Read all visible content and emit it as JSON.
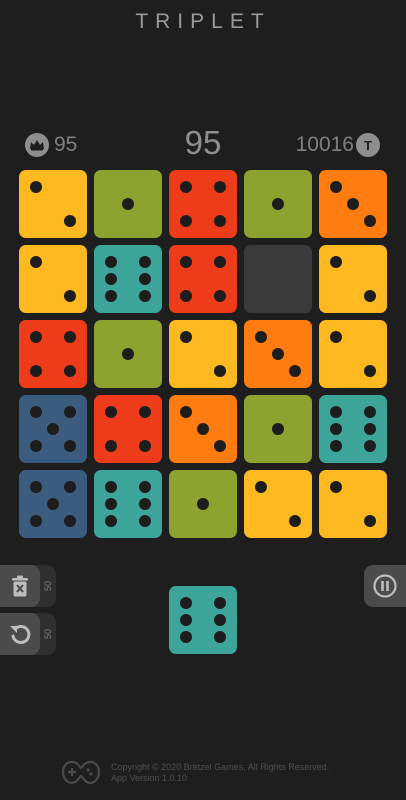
{
  "header": {
    "title": "TRIPLET"
  },
  "scores": {
    "best": "95",
    "current": "95",
    "coins": "10016",
    "token_letter": "T"
  },
  "colors": {
    "yellow": "#fdb91f",
    "olive": "#8ea22f",
    "red": "#ee3c1a",
    "orange": "#ff7c10",
    "teal": "#3da49a",
    "blue": "#3c5c7f",
    "empty": "#3a3a3a"
  },
  "board": [
    [
      {
        "color": "yellow",
        "value": 2
      },
      {
        "color": "olive",
        "value": 1
      },
      {
        "color": "red",
        "value": 4
      },
      {
        "color": "olive",
        "value": 1
      },
      {
        "color": "orange",
        "value": 3
      }
    ],
    [
      {
        "color": "yellow",
        "value": 2
      },
      {
        "color": "teal",
        "value": 6
      },
      {
        "color": "red",
        "value": 4
      },
      {
        "color": "empty",
        "value": 0
      },
      {
        "color": "yellow",
        "value": 2
      }
    ],
    [
      {
        "color": "red",
        "value": 4
      },
      {
        "color": "olive",
        "value": 1
      },
      {
        "color": "yellow",
        "value": 2
      },
      {
        "color": "orange",
        "value": 3
      },
      {
        "color": "yellow",
        "value": 2
      }
    ],
    [
      {
        "color": "blue",
        "value": 5
      },
      {
        "color": "red",
        "value": 4
      },
      {
        "color": "orange",
        "value": 3
      },
      {
        "color": "olive",
        "value": 1
      },
      {
        "color": "teal",
        "value": 6
      }
    ],
    [
      {
        "color": "blue",
        "value": 5
      },
      {
        "color": "teal",
        "value": 6
      },
      {
        "color": "olive",
        "value": 1
      },
      {
        "color": "yellow",
        "value": 2
      },
      {
        "color": "yellow",
        "value": 2
      }
    ]
  ],
  "next_die": {
    "color": "teal",
    "value": 6
  },
  "tools": {
    "trash_cost": "50",
    "undo_cost": "50"
  },
  "footer": {
    "copyright": "Copyright © 2020 Bretzel Games, All Rights Reserved.",
    "version": "App Version 1.0.10"
  },
  "icons": [
    "crown-icon",
    "token-icon",
    "trash-icon",
    "undo-icon",
    "pause-icon",
    "gamepad-logo-icon"
  ]
}
